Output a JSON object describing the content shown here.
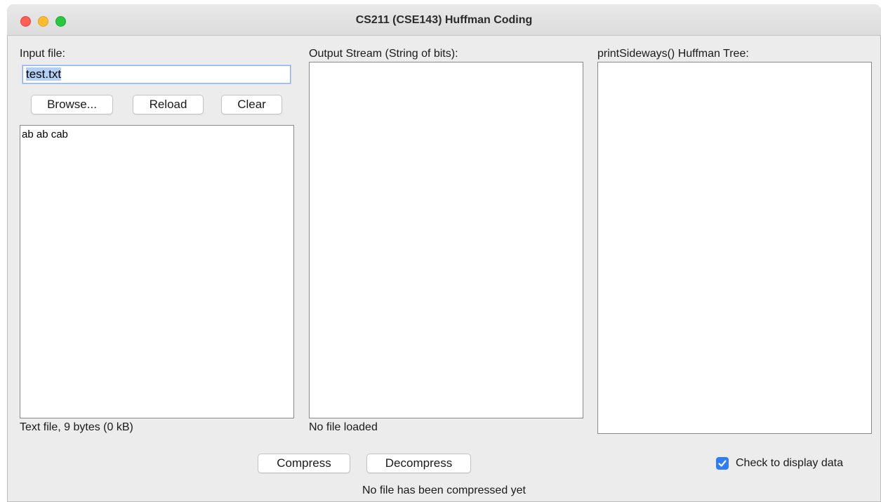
{
  "window": {
    "title": "CS211 (CSE143) Huffman Coding"
  },
  "input": {
    "label": "Input file:",
    "file_value": "test.txt",
    "browse_label": "Browse...",
    "reload_label": "Reload",
    "clear_label": "Clear",
    "content": "ab ab cab",
    "status": "Text file, 9 bytes (0 kB)"
  },
  "output": {
    "label": "Output Stream (String of bits):",
    "content": "",
    "status": "No file loaded"
  },
  "tree": {
    "label": "printSideways() Huffman Tree:",
    "content": ""
  },
  "actions": {
    "compress_label": "Compress",
    "decompress_label": "Decompress",
    "status": "No file has been compressed yet"
  },
  "options": {
    "display_data_label": "Check to display data",
    "display_data_checked": true
  },
  "colors": {
    "accent": "#2f7cf6",
    "selection": "#b3d1f5",
    "close": "#fe5f57",
    "minimize": "#febc2e",
    "maximize": "#28c840"
  }
}
